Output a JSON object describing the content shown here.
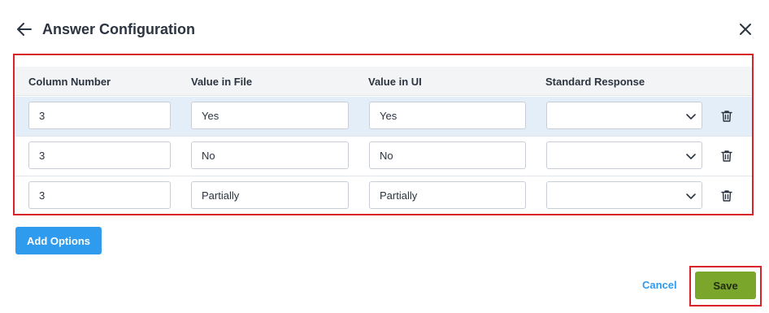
{
  "dialog": {
    "title": "Answer Configuration"
  },
  "table": {
    "columns": [
      "Column Number",
      "Value in File",
      "Value in UI",
      "Standard Response"
    ],
    "rows": [
      {
        "column_number": "3",
        "value_in_file": "Yes",
        "value_in_ui": "Yes",
        "standard_response": ""
      },
      {
        "column_number": "3",
        "value_in_file": "No",
        "value_in_ui": "No",
        "standard_response": ""
      },
      {
        "column_number": "3",
        "value_in_file": "Partially",
        "value_in_ui": "Partially",
        "standard_response": ""
      }
    ]
  },
  "actions": {
    "add_options_label": "Add Options",
    "cancel_label": "Cancel",
    "save_label": "Save"
  },
  "icons": {
    "back": "arrow-left-icon",
    "close": "close-icon",
    "delete": "trash-icon",
    "dropdown": "chevron-down-icon"
  },
  "colors": {
    "highlight_border": "#d8232a",
    "primary": "#2f9bef",
    "save": "#7ba62c",
    "selected_row": "#e3eef9"
  }
}
